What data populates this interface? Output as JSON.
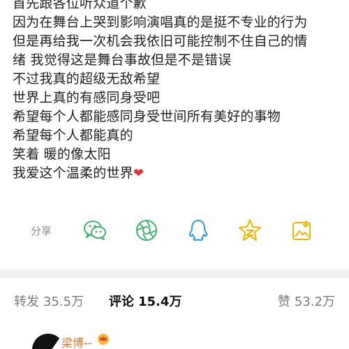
{
  "post": {
    "lines": [
      "首先跟各位听众道个歉",
      "因为在舞台上哭到影响演唱真的是挺不专业的行为",
      "但是再给我一次机会我依旧可能控制不住自己的情",
      "绪  我觉得这是舞台事故但是不是错误",
      "不过我真的超级无敌希望",
      "世界上真的有感同身受吧",
      "希望每个人都能感同身受世间所有美好的事物",
      "希望每个人都能真的",
      "笑着 暖的像太阳",
      "我爱这个温柔的世界"
    ],
    "heart_emoji": "❤"
  },
  "share": {
    "label": "分享",
    "targets": [
      "wechat-icon",
      "moments-icon",
      "qq-icon",
      "qzone-icon",
      "save-image-icon"
    ]
  },
  "tabs": {
    "repost_label": "转发",
    "repost_count": "35.5万",
    "comment_label": "评论",
    "comment_count": "15.4万",
    "like_label": "赞",
    "like_count": "53.2万"
  },
  "comment": {
    "username": "梁博--"
  },
  "colors": {
    "icon_green": "#3cb371",
    "icon_blue": "#2f9be8",
    "icon_yellow": "#f0b400",
    "username_orange": "#e9742b",
    "heart_red": "#e5312f"
  }
}
